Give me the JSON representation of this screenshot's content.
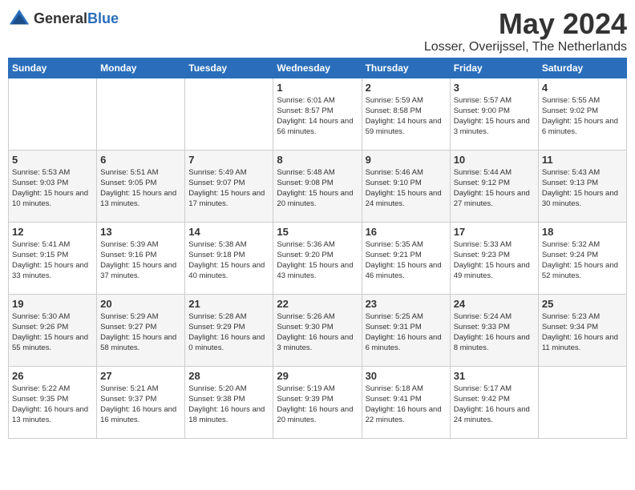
{
  "header": {
    "logo_general": "General",
    "logo_blue": "Blue",
    "month": "May 2024",
    "location": "Losser, Overijssel, The Netherlands"
  },
  "weekdays": [
    "Sunday",
    "Monday",
    "Tuesday",
    "Wednesday",
    "Thursday",
    "Friday",
    "Saturday"
  ],
  "weeks": [
    [
      {
        "day": "",
        "content": ""
      },
      {
        "day": "",
        "content": ""
      },
      {
        "day": "",
        "content": ""
      },
      {
        "day": "1",
        "content": "Sunrise: 6:01 AM\nSunset: 8:57 PM\nDaylight: 14 hours\nand 56 minutes."
      },
      {
        "day": "2",
        "content": "Sunrise: 5:59 AM\nSunset: 8:58 PM\nDaylight: 14 hours\nand 59 minutes."
      },
      {
        "day": "3",
        "content": "Sunrise: 5:57 AM\nSunset: 9:00 PM\nDaylight: 15 hours\nand 3 minutes."
      },
      {
        "day": "4",
        "content": "Sunrise: 5:55 AM\nSunset: 9:02 PM\nDaylight: 15 hours\nand 6 minutes."
      }
    ],
    [
      {
        "day": "5",
        "content": "Sunrise: 5:53 AM\nSunset: 9:03 PM\nDaylight: 15 hours\nand 10 minutes."
      },
      {
        "day": "6",
        "content": "Sunrise: 5:51 AM\nSunset: 9:05 PM\nDaylight: 15 hours\nand 13 minutes."
      },
      {
        "day": "7",
        "content": "Sunrise: 5:49 AM\nSunset: 9:07 PM\nDaylight: 15 hours\nand 17 minutes."
      },
      {
        "day": "8",
        "content": "Sunrise: 5:48 AM\nSunset: 9:08 PM\nDaylight: 15 hours\nand 20 minutes."
      },
      {
        "day": "9",
        "content": "Sunrise: 5:46 AM\nSunset: 9:10 PM\nDaylight: 15 hours\nand 24 minutes."
      },
      {
        "day": "10",
        "content": "Sunrise: 5:44 AM\nSunset: 9:12 PM\nDaylight: 15 hours\nand 27 minutes."
      },
      {
        "day": "11",
        "content": "Sunrise: 5:43 AM\nSunset: 9:13 PM\nDaylight: 15 hours\nand 30 minutes."
      }
    ],
    [
      {
        "day": "12",
        "content": "Sunrise: 5:41 AM\nSunset: 9:15 PM\nDaylight: 15 hours\nand 33 minutes."
      },
      {
        "day": "13",
        "content": "Sunrise: 5:39 AM\nSunset: 9:16 PM\nDaylight: 15 hours\nand 37 minutes."
      },
      {
        "day": "14",
        "content": "Sunrise: 5:38 AM\nSunset: 9:18 PM\nDaylight: 15 hours\nand 40 minutes."
      },
      {
        "day": "15",
        "content": "Sunrise: 5:36 AM\nSunset: 9:20 PM\nDaylight: 15 hours\nand 43 minutes."
      },
      {
        "day": "16",
        "content": "Sunrise: 5:35 AM\nSunset: 9:21 PM\nDaylight: 15 hours\nand 46 minutes."
      },
      {
        "day": "17",
        "content": "Sunrise: 5:33 AM\nSunset: 9:23 PM\nDaylight: 15 hours\nand 49 minutes."
      },
      {
        "day": "18",
        "content": "Sunrise: 5:32 AM\nSunset: 9:24 PM\nDaylight: 15 hours\nand 52 minutes."
      }
    ],
    [
      {
        "day": "19",
        "content": "Sunrise: 5:30 AM\nSunset: 9:26 PM\nDaylight: 15 hours\nand 55 minutes."
      },
      {
        "day": "20",
        "content": "Sunrise: 5:29 AM\nSunset: 9:27 PM\nDaylight: 15 hours\nand 58 minutes."
      },
      {
        "day": "21",
        "content": "Sunrise: 5:28 AM\nSunset: 9:29 PM\nDaylight: 16 hours\nand 0 minutes."
      },
      {
        "day": "22",
        "content": "Sunrise: 5:26 AM\nSunset: 9:30 PM\nDaylight: 16 hours\nand 3 minutes."
      },
      {
        "day": "23",
        "content": "Sunrise: 5:25 AM\nSunset: 9:31 PM\nDaylight: 16 hours\nand 6 minutes."
      },
      {
        "day": "24",
        "content": "Sunrise: 5:24 AM\nSunset: 9:33 PM\nDaylight: 16 hours\nand 8 minutes."
      },
      {
        "day": "25",
        "content": "Sunrise: 5:23 AM\nSunset: 9:34 PM\nDaylight: 16 hours\nand 11 minutes."
      }
    ],
    [
      {
        "day": "26",
        "content": "Sunrise: 5:22 AM\nSunset: 9:35 PM\nDaylight: 16 hours\nand 13 minutes."
      },
      {
        "day": "27",
        "content": "Sunrise: 5:21 AM\nSunset: 9:37 PM\nDaylight: 16 hours\nand 16 minutes."
      },
      {
        "day": "28",
        "content": "Sunrise: 5:20 AM\nSunset: 9:38 PM\nDaylight: 16 hours\nand 18 minutes."
      },
      {
        "day": "29",
        "content": "Sunrise: 5:19 AM\nSunset: 9:39 PM\nDaylight: 16 hours\nand 20 minutes."
      },
      {
        "day": "30",
        "content": "Sunrise: 5:18 AM\nSunset: 9:41 PM\nDaylight: 16 hours\nand 22 minutes."
      },
      {
        "day": "31",
        "content": "Sunrise: 5:17 AM\nSunset: 9:42 PM\nDaylight: 16 hours\nand 24 minutes."
      },
      {
        "day": "",
        "content": ""
      }
    ]
  ]
}
